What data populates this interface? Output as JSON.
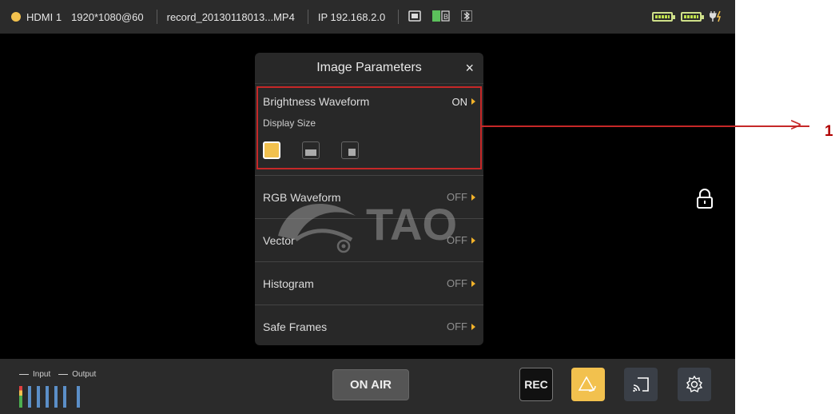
{
  "status": {
    "input": "HDMI 1",
    "resolution": "1920*1080@60",
    "filename": "record_20130118013...MP4",
    "ip": "IP 192.168.2.0",
    "icons": [
      "sd-card-icon",
      "storage-icon",
      "bluetooth-icon",
      "battery-icon",
      "battery-icon",
      "power-plug-icon"
    ]
  },
  "panel": {
    "title": "Image Parameters",
    "close_icon": "×",
    "brightness": {
      "label": "Brightness Waveform",
      "state": "ON",
      "display_size_label": "Display Size"
    },
    "rows": [
      {
        "label": "RGB Waveform",
        "state": "OFF"
      },
      {
        "label": "Vector",
        "state": "OFF"
      },
      {
        "label": "Histogram",
        "state": "OFF"
      },
      {
        "label": "Safe Frames",
        "state": "OFF"
      }
    ]
  },
  "watermark": {
    "text": "TAO"
  },
  "callout": {
    "number": "1"
  },
  "bottom": {
    "legend_input": "Input",
    "legend_output": "Output",
    "onair_label": "ON AIR",
    "rec_label": "REC"
  },
  "colors": {
    "accent": "#f2c14e",
    "highlight": "#c62828",
    "panel": "#282828"
  }
}
